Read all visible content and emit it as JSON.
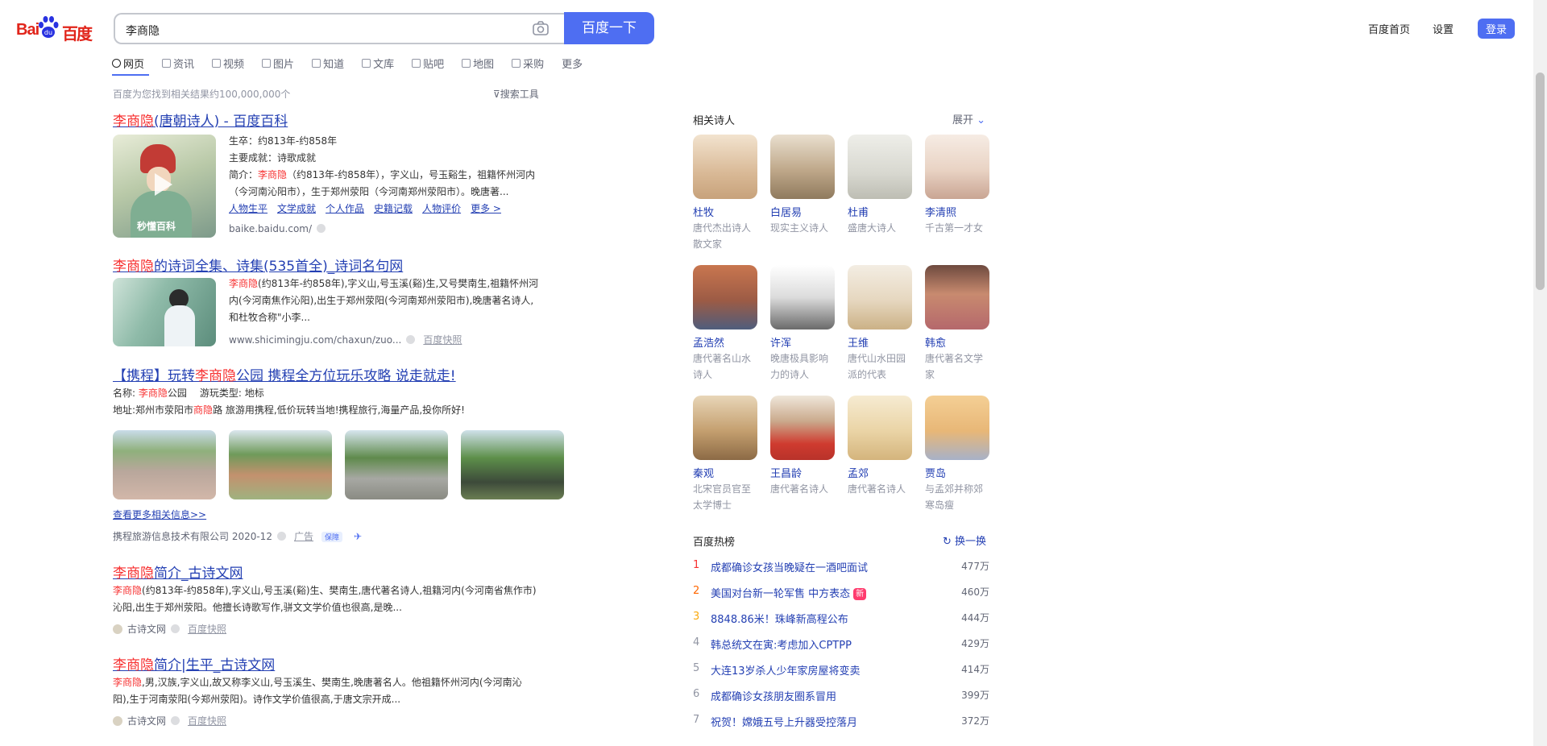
{
  "header": {
    "logo_latin": "Bai du",
    "logo_cn": "百度",
    "search_query": "李商隐",
    "search_button": "百度一下",
    "links": [
      "百度首页",
      "设置"
    ],
    "login": "登录"
  },
  "tabs": [
    "网页",
    "资讯",
    "视频",
    "图片",
    "知道",
    "文库",
    "贴吧",
    "地图",
    "采购",
    "更多"
  ],
  "result_count": "百度为您找到相关结果约100,000,000个",
  "search_tools": "搜索工具",
  "results": {
    "r1": {
      "title_hl": "李商隐",
      "title_rest": "(唐朝诗人) - 百度百科",
      "line1": "生卒：约813年-约858年",
      "line2": "主要成就：诗歌成就",
      "line3_pre": "简介：",
      "line3_hl": "李商隐",
      "line3_rest": "（约813年-约858年），字义山，号玉谿生，祖籍怀州河内",
      "line4": "（今河南沁阳市），生于郑州荥阳（今河南郑州荥阳市）。晚唐著...",
      "sublinks": [
        "人物生平",
        "文学成就",
        "个人作品",
        "史籍记载",
        "人物评价",
        "更多 >"
      ],
      "source": "baike.baidu.com/",
      "thumb_caption": "秒懂百科"
    },
    "r2": {
      "title_hl": "李商隐",
      "title_rest": "的诗词全集、诗集(535首全)_诗词名句网",
      "line1_hl": "李商隐",
      "line1_rest": "(约813年-约858年),字义山,号玉溪(谿)生,又号樊南生,祖籍怀州河",
      "line2": "内(今河南焦作沁阳),出生于郑州荥阳(今河南郑州荥阳市),晚唐著名诗人,",
      "line3": "和杜牧合称\"小李...",
      "source": "www.shicimingju.com/chaxun/zuo...",
      "snapshot": "百度快照"
    },
    "r3": {
      "title_pre": "【携程】玩转",
      "title_hl": "李商隐",
      "title_rest": "公园 携程全方位玩乐攻略 说走就走!",
      "info1_label": "名称: ",
      "info1_hl": "李商隐",
      "info1_rest": "公园",
      "info1_type": "游玩类型: 地标",
      "info2_pre": "地址:郑州市荥阳市",
      "info2_hl": "商隐",
      "info2_rest": "路 旅游用携程,低价玩转当地!携程旅行,海量产品,投你所好!",
      "more": "查看更多相关信息>>",
      "source": "携程旅游信息技术有限公司 2020-12",
      "ad": "广告",
      "badge": "保障"
    },
    "r4": {
      "title_hl": "李商隐",
      "title_rest": "简介_古诗文网",
      "line1_hl": "李商隐",
      "line1_rest": "(约813年-约858年),字义山,号玉溪(谿)生、樊南生,唐代著名诗人,祖籍河内(今河南省焦作市)",
      "line2": "沁阳,出生于郑州荥阳。他擅长诗歌写作,骈文文学价值也很高,是晚...",
      "source": "古诗文网",
      "snapshot": "百度快照"
    },
    "r5": {
      "title_hl": "李商隐",
      "title_rest": "简介|生平_古诗文网",
      "line1_hl": "李商隐",
      "line1_rest": ",男,汉族,字义山,故又称李义山,号玉溪生、樊南生,晚唐著名人。他祖籍怀州河内(今河南沁",
      "line2": "阳),生于河南荥阳(今郑州荥阳)。诗作文学价值很高,于唐文宗开成...",
      "source": "古诗文网",
      "snapshot": "百度快照"
    }
  },
  "right": {
    "poets_title": "相关诗人",
    "expand": "展开",
    "poets": [
      {
        "name": "杜牧",
        "desc": "唐代杰出诗人散文家"
      },
      {
        "name": "白居易",
        "desc": "现实主义诗人"
      },
      {
        "name": "杜甫",
        "desc": "盛唐大诗人"
      },
      {
        "name": "李清照",
        "desc": "千古第一才女"
      },
      {
        "name": "孟浩然",
        "desc": "唐代著名山水诗人"
      },
      {
        "name": "许浑",
        "desc": "晚唐极具影响力的诗人"
      },
      {
        "name": "王维",
        "desc": "唐代山水田园派的代表"
      },
      {
        "name": "韩愈",
        "desc": "唐代著名文学家"
      },
      {
        "name": "秦观",
        "desc": "北宋官员官至太学博士"
      },
      {
        "name": "王昌龄",
        "desc": "唐代著名诗人"
      },
      {
        "name": "孟郊",
        "desc": "唐代著名诗人"
      },
      {
        "name": "贾岛",
        "desc": "与孟郊并称郊寒岛瘦"
      }
    ],
    "hot_title": "百度热榜",
    "refresh": "换一换",
    "hot": [
      {
        "rank": "1",
        "title": "成都确诊女孩当晚疑在一酒吧面试",
        "count": "477万",
        "color": "#f73131"
      },
      {
        "rank": "2",
        "title": "美国对台新一轮军售 中方表态",
        "count": "460万",
        "color": "#ff6600",
        "new": "新"
      },
      {
        "rank": "3",
        "title": "8848.86米！珠峰新高程公布",
        "count": "444万",
        "color": "#faa90e"
      },
      {
        "rank": "4",
        "title": "韩总统文在寅:考虑加入CPTPP",
        "count": "429万"
      },
      {
        "rank": "5",
        "title": "大连13岁杀人少年家房屋将变卖",
        "count": "414万"
      },
      {
        "rank": "6",
        "title": "成都确诊女孩朋友圈系冒用",
        "count": "399万"
      },
      {
        "rank": "7",
        "title": "祝贺！嫦娥五号上升器受控落月",
        "count": "372万"
      }
    ]
  }
}
